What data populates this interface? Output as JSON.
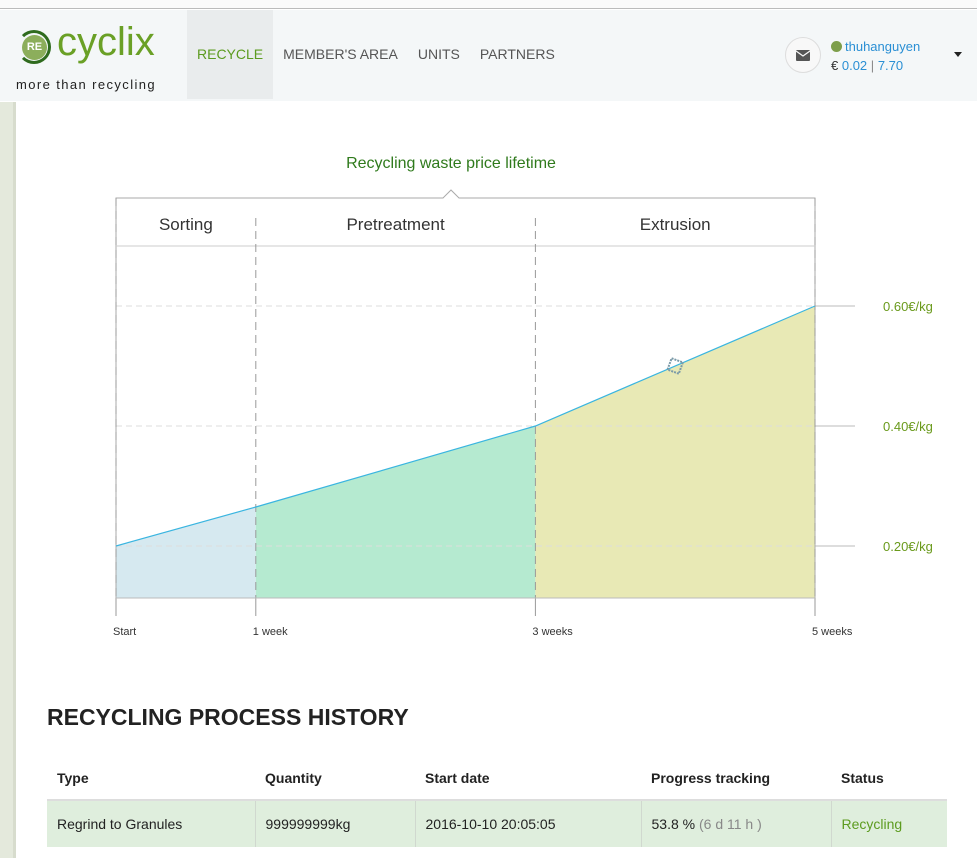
{
  "nav": {
    "logo_badge": "RE",
    "logo_word": "cyclix",
    "logo_tagline": "more than recycling",
    "items": [
      {
        "label": "RECYCLE",
        "active": true
      },
      {
        "label": "MEMBER'S AREA"
      },
      {
        "label": "UNITS"
      },
      {
        "label": "PARTNERS"
      }
    ]
  },
  "user": {
    "name": "thuhanguyen",
    "currency": "€",
    "balance1": "0.02",
    "separator": "|",
    "balance2": "7.70",
    "status_color": "#7d9e4a"
  },
  "chart_data": {
    "type": "area",
    "title": "Recycling waste price lifetime",
    "phases": [
      {
        "name": "Sorting",
        "from": 0,
        "to": 1
      },
      {
        "name": "Pretreatment",
        "from": 1,
        "to": 3
      },
      {
        "name": "Extrusion",
        "from": 3,
        "to": 5
      }
    ],
    "x": [
      0,
      1,
      3,
      5
    ],
    "y": [
      0.2,
      0.265,
      0.4,
      0.6
    ],
    "xticks": [
      {
        "v": 0,
        "label": "Start"
      },
      {
        "v": 1,
        "label": "1 week"
      },
      {
        "v": 3,
        "label": "3 weeks"
      },
      {
        "v": 5,
        "label": "5 weeks"
      }
    ],
    "yticks": [
      {
        "v": 0.2,
        "label": "0.20€/kg"
      },
      {
        "v": 0.4,
        "label": "0.40€/kg"
      },
      {
        "v": 0.6,
        "label": "0.60€/kg"
      }
    ],
    "marker": {
      "x": 4,
      "y": 0.5
    },
    "ylim": [
      0.113,
      0.6
    ],
    "xlim": [
      0,
      5
    ],
    "colors": [
      "#d6e9f0",
      "#b5ead0",
      "#e8e9b5"
    ],
    "line_color": "#3ab5e0"
  },
  "history": {
    "title": "RECYCLING PROCESS HISTORY",
    "columns": [
      "Type",
      "Quantity",
      "Start date",
      "Progress tracking",
      "Status"
    ],
    "rows": [
      {
        "type": "Regrind to Granules",
        "quantity": "999999999kg",
        "start": "2016-10-10 20:05:05",
        "progress": "53.8 %",
        "remaining": "(6 d 11 h )",
        "status": "Recycling"
      }
    ]
  }
}
